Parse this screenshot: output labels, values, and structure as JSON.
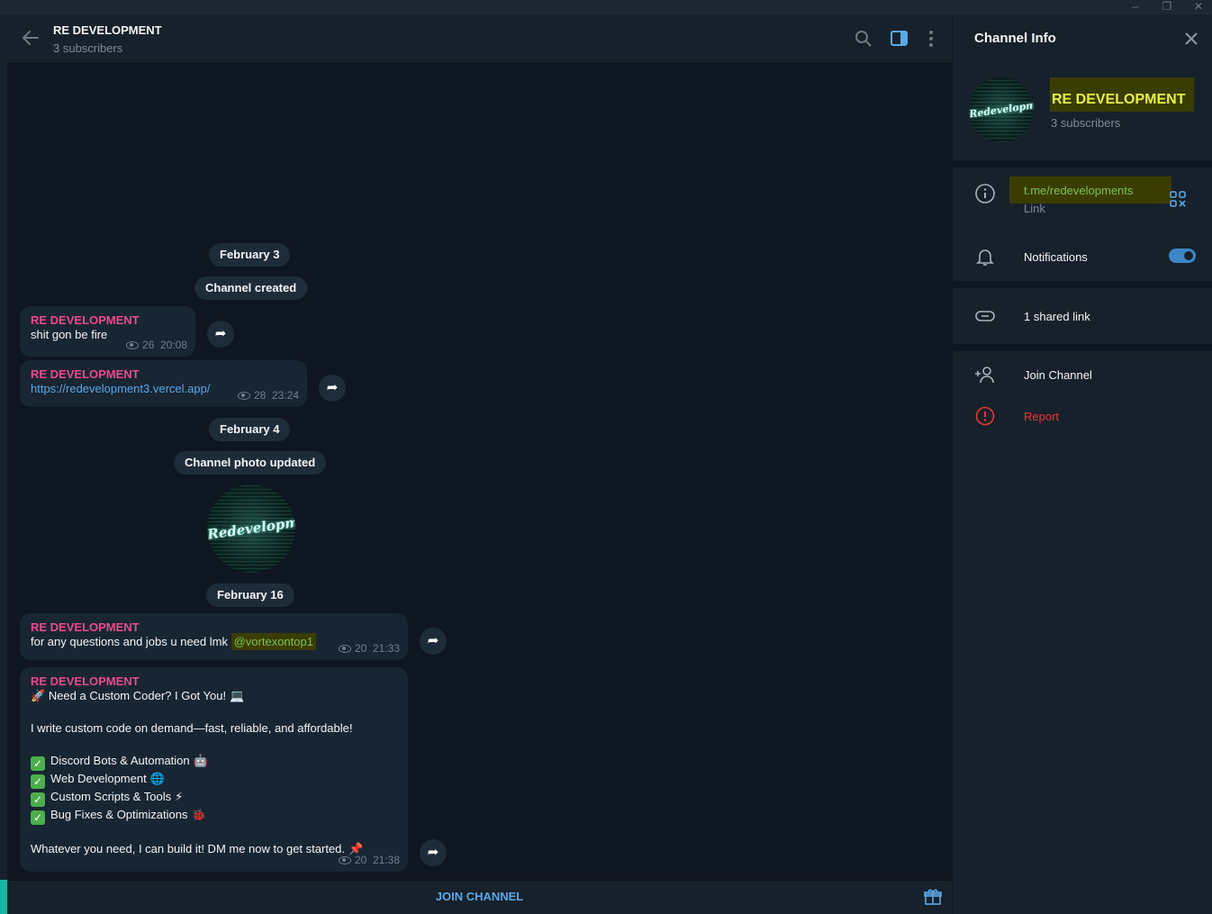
{
  "window": {
    "minimize": "–",
    "restore": "❐",
    "close": "✕"
  },
  "header": {
    "title": "RE DEVELOPMENT",
    "subtitle": "3 subscribers"
  },
  "dates": {
    "d1": "February 3",
    "d2": "February 4",
    "d3": "February 16"
  },
  "services": {
    "channel_created": "Channel created",
    "photo_updated": "Channel photo updated"
  },
  "avatar_text": "Redevelopment",
  "messages": [
    {
      "author": "RE DEVELOPMENT",
      "text": "shit gon be fire",
      "views": "26",
      "time": "20:08"
    },
    {
      "author": "RE DEVELOPMENT",
      "text": "https://redevelopment3.vercel.app/",
      "views": "28",
      "time": "23:24"
    },
    {
      "author": "RE DEVELOPMENT",
      "text": "for any questions and jobs u need lmk ",
      "mention": "@vortexontop1",
      "views": "20",
      "time": "21:33"
    },
    {
      "author": "RE DEVELOPMENT",
      "line1": "Need a Custom Coder? I Got You!",
      "line2": "I write custom code on demand—fast, reliable, and affordable!",
      "items": [
        "Discord Bots & Automation",
        "Web Development",
        "Custom Scripts & Tools",
        "Bug Fixes & Optimizations"
      ],
      "closing": "Whatever you need, I can build it! DM me now to get started.",
      "views": "20",
      "time": "21:38"
    }
  ],
  "bottom": {
    "join": "JOIN CHANNEL"
  },
  "side": {
    "title": "Channel Info",
    "name": "RE DEVELOPMENT",
    "subscribers": "3 subscribers",
    "link": "t.me/redevelopments",
    "link_label": "Link",
    "notifications": "Notifications",
    "notifications_on": true,
    "shared": "1 shared link",
    "join": "Join Channel",
    "report": "Report"
  },
  "colors": {
    "accent": "#5ba8e6",
    "author": "#e64d8a",
    "report": "#e53935",
    "highlight": "#3a3d00"
  }
}
